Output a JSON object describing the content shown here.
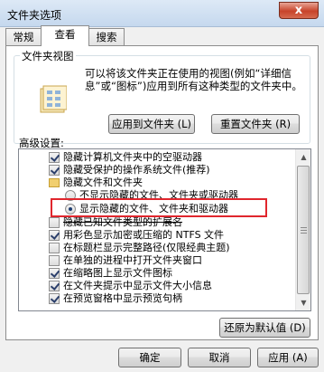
{
  "window": {
    "title": "文件夹选项",
    "close_label": "x"
  },
  "tabs": [
    {
      "label": "常规"
    },
    {
      "label": "查看"
    },
    {
      "label": "搜索"
    }
  ],
  "folder_views": {
    "group_label": "文件夹视图",
    "description": "可以将该文件夹正在使用的视图(例如“详细信息”或“图标”)应用到所有这种类型的文件夹中。",
    "apply_button": "应用到文件夹 (L)",
    "reset_button": "重置文件夹 (R)"
  },
  "advanced": {
    "label": "高级设置:",
    "items": [
      {
        "text": "隐藏计算机文件夹中的空驱动器",
        "type": "checkbox",
        "checked": true
      },
      {
        "text": "隐藏受保护的操作系统文件(推荐)",
        "type": "checkbox",
        "checked": true
      },
      {
        "text": "隐藏文件和文件夹",
        "type": "folder"
      },
      {
        "text": "不显示隐藏的文件、文件夹或驱动器",
        "type": "radio",
        "checked": false
      },
      {
        "text": "显示隐藏的文件、文件夹和驱动器",
        "type": "radio",
        "checked": true
      },
      {
        "text": "隐藏已知文件类型的扩展名",
        "type": "checkbox",
        "checked": false
      },
      {
        "text": "用彩色显示加密或压缩的 NTFS 文件",
        "type": "checkbox",
        "checked": true
      },
      {
        "text": "在标题栏显示完整路径(仅限经典主题)",
        "type": "checkbox",
        "checked": false
      },
      {
        "text": "在单独的进程中打开文件夹窗口",
        "type": "checkbox",
        "checked": false
      },
      {
        "text": "在缩略图上显示文件图标",
        "type": "checkbox",
        "checked": true
      },
      {
        "text": "在文件夹提示中显示文件大小信息",
        "type": "checkbox",
        "checked": true
      },
      {
        "text": "在预览窗格中显示预览句柄",
        "type": "checkbox",
        "checked": true
      }
    ],
    "restore_button": "还原为默认值 (D)"
  },
  "footer": {
    "ok_button": "确定",
    "cancel_button": "取消",
    "apply_button": "应用 (A)"
  },
  "colors": {
    "highlight_border": "#e0262d"
  }
}
